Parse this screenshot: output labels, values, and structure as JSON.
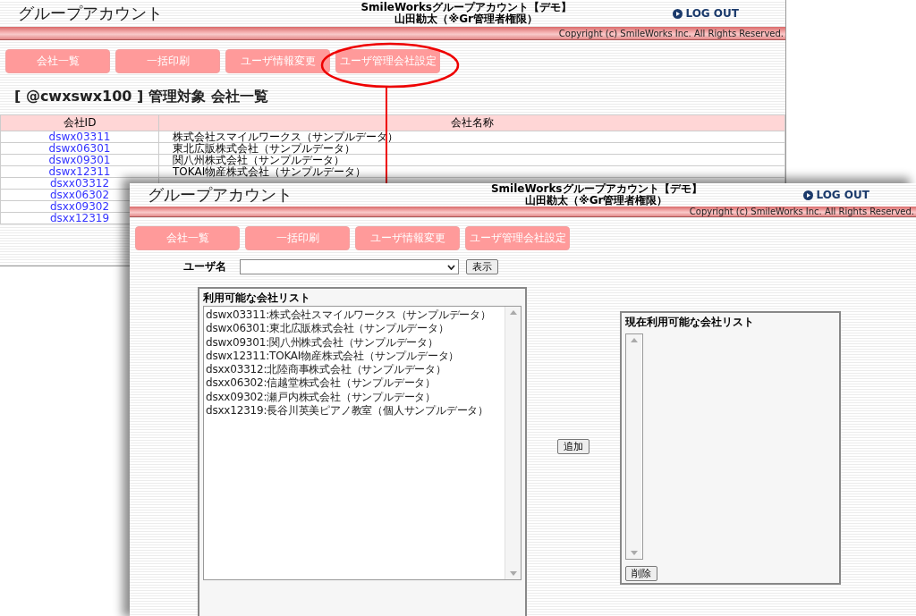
{
  "back_window": {
    "title": "グループアカウント",
    "app_name": "SmileWorksグループアカウント【デモ】",
    "user": "山田勘太（※Gr管理者権限）",
    "logout": "LOG OUT",
    "copyright": "Copyright (c) SmileWorks Inc. All Rights Reserved.",
    "nav": [
      "会社一覧",
      "一括印刷",
      "ユーザ情報変更",
      "ユーザ管理会社設定"
    ],
    "heading": "[ @cwxswx100 ] 管理対象 会社一覧",
    "table": {
      "columns": [
        "会社ID",
        "会社名称"
      ],
      "rows": [
        {
          "id": "dswx03311",
          "name": "株式会社スマイルワークス（サンプルデータ）"
        },
        {
          "id": "dswx06301",
          "name": "東北広販株式会社（サンプルデータ）"
        },
        {
          "id": "dswx09301",
          "name": "関八州株式会社（サンプルデータ）"
        },
        {
          "id": "dswx12311",
          "name": "TOKAI物産株式会社（サンプルデータ）"
        },
        {
          "id": "dsxx03312"
        },
        {
          "id": "dsxx06302"
        },
        {
          "id": "dsxx09302"
        },
        {
          "id": "dsxx12319"
        }
      ]
    }
  },
  "front_window": {
    "title": "グループアカウント",
    "app_name": "SmileWorksグループアカウント【デモ】",
    "user": "山田勘太（※Gr管理者権限）",
    "logout": "LOG OUT",
    "copyright": "Copyright (c) SmileWorks Inc. All Rights Reserved.",
    "nav": [
      "会社一覧",
      "一括印刷",
      "ユーザ情報変更",
      "ユーザ管理会社設定"
    ],
    "user_field": {
      "label": "ユーザ名"
    },
    "show_button": "表示",
    "available": {
      "title": "利用可能な会社リスト",
      "items": [
        "dswx03311:株式会社スマイルワークス（サンプルデータ）",
        "dswx06301:東北広販株式会社（サンプルデータ）",
        "dswx09301:関八州株式会社（サンプルデータ）",
        "dswx12311:TOKAI物産株式会社（サンプルデータ）",
        "dsxx03312:北陸商事株式会社（サンプルデータ）",
        "dsxx06302:信越堂株式会社（サンプルデータ）",
        "dsxx09302:瀬戸内株式会社（サンプルデータ）",
        "dsxx12319:長谷川英美ピアノ教室（個人サンプルデータ）"
      ]
    },
    "add_button": "追加",
    "current": {
      "title": "現在利用可能な会社リスト"
    },
    "remove_button": "削除"
  }
}
